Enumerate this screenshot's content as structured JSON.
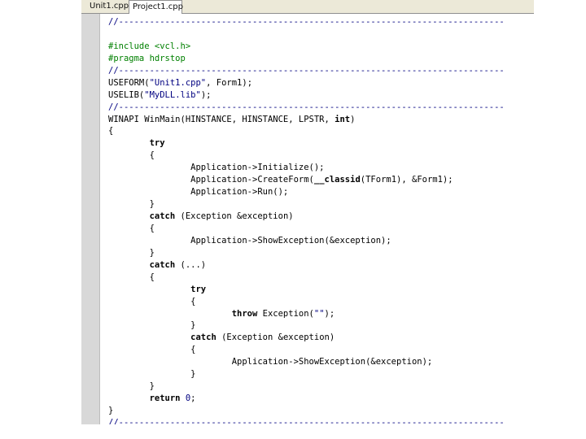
{
  "tabs": [
    {
      "label": "Unit1.cpp",
      "active": false
    },
    {
      "label": "Project1.cpp",
      "active": true
    }
  ],
  "colors": {
    "comment": "#000080",
    "directive": "#008000",
    "keyword": "#000000",
    "string": "#000080"
  },
  "code": [
    [
      {
        "t": "comment",
        "s": "//---------------------------------------------------------------------------"
      }
    ],
    [
      {
        "t": "plain",
        "s": ""
      }
    ],
    [
      {
        "t": "directive",
        "s": "#include <vcl.h>"
      }
    ],
    [
      {
        "t": "directive",
        "s": "#pragma hdrstop"
      }
    ],
    [
      {
        "t": "comment",
        "s": "//---------------------------------------------------------------------------"
      }
    ],
    [
      {
        "t": "plain",
        "s": "USEFORM("
      },
      {
        "t": "string",
        "s": "\"Unit1.cpp\""
      },
      {
        "t": "plain",
        "s": ", Form1);"
      }
    ],
    [
      {
        "t": "plain",
        "s": "USELIB("
      },
      {
        "t": "string",
        "s": "\"MyDLL.lib\""
      },
      {
        "t": "plain",
        "s": ");"
      }
    ],
    [
      {
        "t": "comment",
        "s": "//---------------------------------------------------------------------------"
      }
    ],
    [
      {
        "t": "plain",
        "s": "WINAPI WinMain(HINSTANCE, HINSTANCE, LPSTR, "
      },
      {
        "t": "keyword",
        "s": "int"
      },
      {
        "t": "plain",
        "s": ")"
      }
    ],
    [
      {
        "t": "plain",
        "s": "{"
      }
    ],
    [
      {
        "t": "plain",
        "s": "        "
      },
      {
        "t": "keyword",
        "s": "try"
      }
    ],
    [
      {
        "t": "plain",
        "s": "        {"
      }
    ],
    [
      {
        "t": "plain",
        "s": "                Application->Initialize();"
      }
    ],
    [
      {
        "t": "plain",
        "s": "                Application->CreateForm("
      },
      {
        "t": "keyword",
        "s": "__classid"
      },
      {
        "t": "plain",
        "s": "(TForm1), &Form1);"
      }
    ],
    [
      {
        "t": "plain",
        "s": "                Application->Run();"
      }
    ],
    [
      {
        "t": "plain",
        "s": "        }"
      }
    ],
    [
      {
        "t": "plain",
        "s": "        "
      },
      {
        "t": "keyword",
        "s": "catch"
      },
      {
        "t": "plain",
        "s": " (Exception &exception)"
      }
    ],
    [
      {
        "t": "plain",
        "s": "        {"
      }
    ],
    [
      {
        "t": "plain",
        "s": "                Application->ShowException(&exception);"
      }
    ],
    [
      {
        "t": "plain",
        "s": "        }"
      }
    ],
    [
      {
        "t": "plain",
        "s": "        "
      },
      {
        "t": "keyword",
        "s": "catch"
      },
      {
        "t": "plain",
        "s": " (...)"
      }
    ],
    [
      {
        "t": "plain",
        "s": "        {"
      }
    ],
    [
      {
        "t": "plain",
        "s": "                "
      },
      {
        "t": "keyword",
        "s": "try"
      }
    ],
    [
      {
        "t": "plain",
        "s": "                {"
      }
    ],
    [
      {
        "t": "plain",
        "s": "                        "
      },
      {
        "t": "keyword",
        "s": "throw"
      },
      {
        "t": "plain",
        "s": " Exception("
      },
      {
        "t": "string",
        "s": "\"\""
      },
      {
        "t": "plain",
        "s": ");"
      }
    ],
    [
      {
        "t": "plain",
        "s": "                }"
      }
    ],
    [
      {
        "t": "plain",
        "s": "                "
      },
      {
        "t": "keyword",
        "s": "catch"
      },
      {
        "t": "plain",
        "s": " (Exception &exception)"
      }
    ],
    [
      {
        "t": "plain",
        "s": "                {"
      }
    ],
    [
      {
        "t": "plain",
        "s": "                        Application->ShowException(&exception);"
      }
    ],
    [
      {
        "t": "plain",
        "s": "                }"
      }
    ],
    [
      {
        "t": "plain",
        "s": "        }"
      }
    ],
    [
      {
        "t": "plain",
        "s": "        "
      },
      {
        "t": "keyword",
        "s": "return"
      },
      {
        "t": "plain",
        "s": " "
      },
      {
        "t": "number",
        "s": "0"
      },
      {
        "t": "plain",
        "s": ";"
      }
    ],
    [
      {
        "t": "plain",
        "s": "}"
      }
    ],
    [
      {
        "t": "comment",
        "s": "//---------------------------------------------------------------------------"
      }
    ]
  ]
}
